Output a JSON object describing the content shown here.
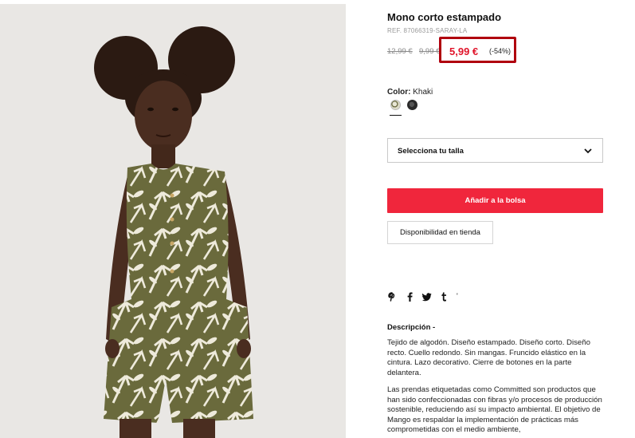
{
  "product": {
    "title": "Mono corto estampado",
    "ref": "REF. 87066319-SARAY-LA",
    "old_price_1": "12,99 €",
    "old_price_2": "9,99 €",
    "price": "5,99 €",
    "discount": "(-54%)",
    "highlight_color": "#b0000e",
    "price_color": "#e0142a"
  },
  "color": {
    "label": "Color:",
    "value": "Khaki",
    "swatches": [
      {
        "name": "khaki-print",
        "selected": true
      },
      {
        "name": "dark-grey",
        "selected": false
      }
    ]
  },
  "size_select": {
    "label": "Selecciona tu talla",
    "icon": "chevron-down-icon"
  },
  "buttons": {
    "add_to_bag": "Añadir a la bolsa",
    "add_color": "#f0263c",
    "store_availability": "Disponibilidad en tienda"
  },
  "social": [
    {
      "icon": "pinterest-icon",
      "glyph": "P"
    },
    {
      "icon": "facebook-icon",
      "glyph": "f"
    },
    {
      "icon": "twitter-icon",
      "glyph": "t"
    },
    {
      "icon": "tumblr-icon",
      "glyph": "t"
    },
    {
      "icon": "more-icon",
      "glyph": "'"
    }
  ],
  "description": {
    "heading": "Descripción -",
    "paragraph_1": "Tejido de algodón. Diseño estampado. Diseño corto. Diseño recto. Cuello redondo. Sin mangas. Fruncido elástico en la cintura. Lazo decorativo. Cierre de botones en la parte delantera.",
    "paragraph_2": "Las prendas etiquetadas como Committed son productos que han sido confeccionadas con fibras y/o procesos de producción sostenible, reduciendo así su impacto ambiental. El objetivo de Mango es respaldar la implementación de prácticas más comprometidas con el medio ambiente,"
  }
}
